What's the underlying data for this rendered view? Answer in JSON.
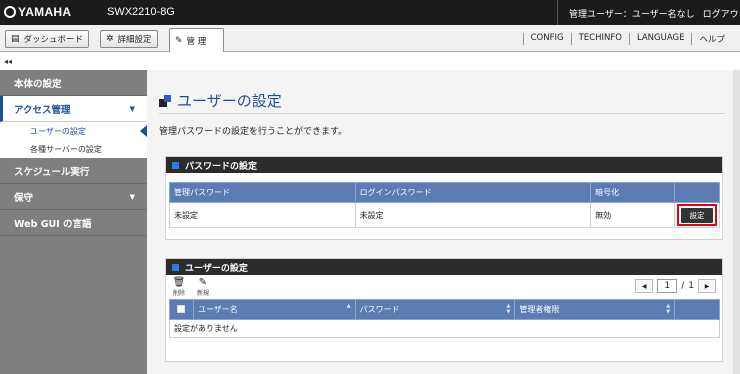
{
  "header": {
    "brand": "YAMAHA",
    "model": "SWX2210-8G",
    "user_label": "管理ユーザー：ユーザー名なし",
    "logout": "ログアウト"
  },
  "tabs": [
    {
      "label": "ダッシュボード",
      "icon": "dashboard-icon"
    },
    {
      "label": "詳細設定",
      "icon": "gear-icon"
    },
    {
      "label": "管 理",
      "icon": "wrench-icon"
    }
  ],
  "right_nav": [
    "CONFIG",
    "TECHINFO",
    "LANGUAGE",
    "ヘルプ"
  ],
  "collapse_glyph": "◂◂",
  "sidebar": {
    "items": [
      {
        "label": "本体の設定"
      },
      {
        "label": "アクセス管理",
        "arrow": "▼"
      },
      {
        "label": "ユーザーの設定"
      },
      {
        "label": "各種サーバーの設定"
      },
      {
        "label": "スケジュール実行"
      },
      {
        "label": "保守",
        "arrow": "▼"
      },
      {
        "label": "Web GUI の言語"
      }
    ]
  },
  "main": {
    "title": "ユーザーの設定",
    "description": "管理パスワードの設定を行うことができます。",
    "password_panel": {
      "title": "パスワードの設定",
      "columns": [
        "管理パスワード",
        "ログインパスワード",
        "暗号化",
        ""
      ],
      "row": [
        "未設定",
        "未設定",
        "無効"
      ],
      "set_button": "設定"
    },
    "user_panel": {
      "title": "ユーザーの設定",
      "delete_label": "削除",
      "new_label": "新規",
      "page_current": "1",
      "page_sep": "/",
      "page_total": "1",
      "prev_glyph": "◀",
      "next_glyph": "▶",
      "columns": [
        "ユーザー名",
        "パスワード",
        "管理者権限"
      ],
      "empty_text": "設定がありません"
    }
  },
  "colors": {
    "accent": "#1a4f9c",
    "table_header": "#5b7bb3",
    "highlight": "#e60012"
  }
}
